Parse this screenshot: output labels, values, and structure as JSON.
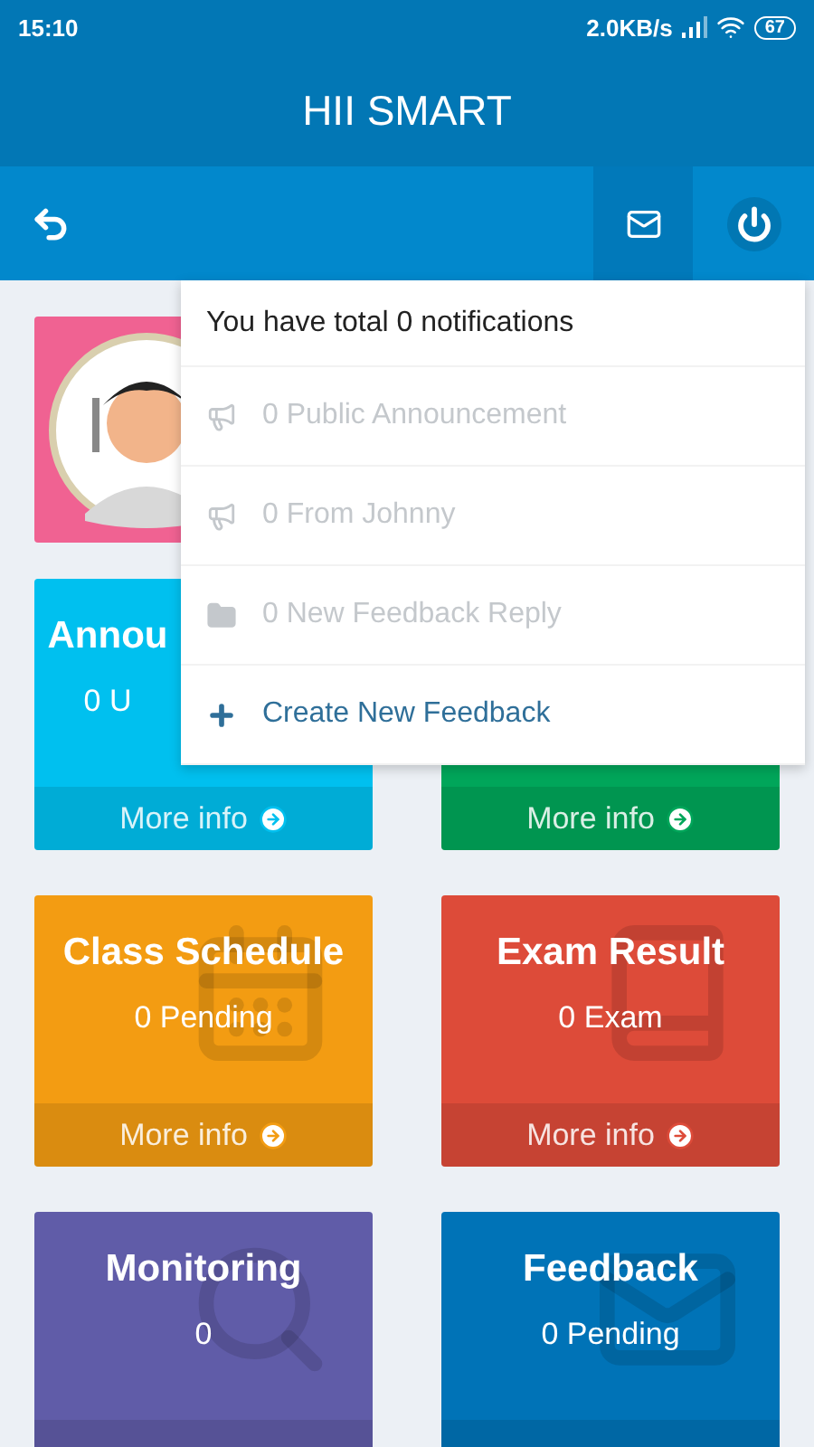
{
  "status_bar": {
    "time": "15:10",
    "speed": "2.0KB/s",
    "battery": "67"
  },
  "window": {
    "title": "HII SMART"
  },
  "toolbar": {
    "mail_active": true
  },
  "cards": [
    {
      "title": "Annou",
      "subtitle": "0 U",
      "footer": "More info",
      "color": "#00c0ef"
    },
    {
      "footer": "More info",
      "color": "#00a65a"
    },
    {
      "title": "Class Schedule",
      "subtitle": "0 Pending",
      "footer": "More info",
      "color": "#f39c12"
    },
    {
      "title": "Exam Result",
      "subtitle": "0 Exam",
      "footer": "More info",
      "color": "#dd4b39"
    },
    {
      "title": "Monitoring",
      "subtitle": "0",
      "color": "#605ca8"
    },
    {
      "title": "Feedback",
      "subtitle": "0 Pending",
      "color": "#0073b7"
    }
  ],
  "notifications": {
    "header": "You have total 0 notifications",
    "items": [
      {
        "kind": "announcement",
        "label": "0 Public Announcement",
        "disabled": true
      },
      {
        "kind": "announcement",
        "label": "0 From Johnny",
        "disabled": true
      },
      {
        "kind": "folder",
        "label": "0 New Feedback Reply",
        "disabled": true
      },
      {
        "kind": "create",
        "label": "Create New Feedback",
        "disabled": false
      }
    ]
  }
}
